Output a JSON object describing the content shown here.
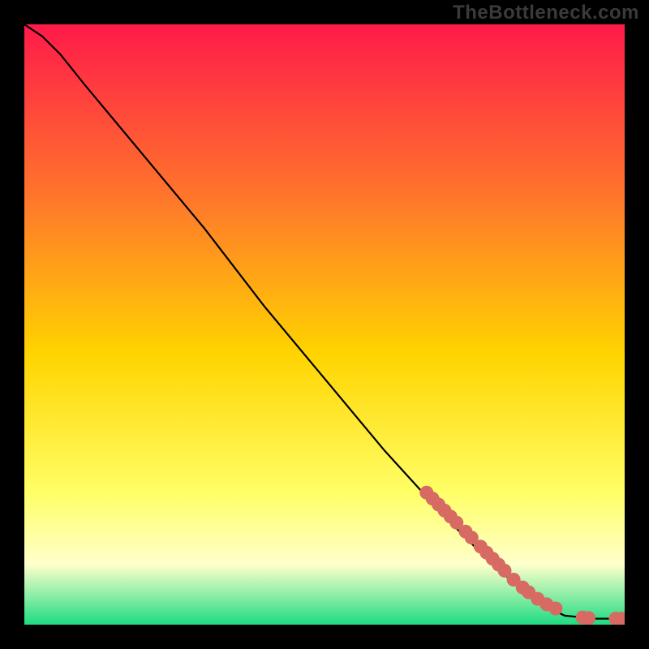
{
  "watermark": "TheBottleneck.com",
  "colors": {
    "gradient_top": "#ff1a4a",
    "gradient_mid1": "#ff7a2a",
    "gradient_mid2": "#ffd400",
    "gradient_mid3": "#ffff66",
    "gradient_mid4": "#ffffcc",
    "gradient_bottom": "#1edc82",
    "curve": "#000000",
    "marker_fill": "#d76a62",
    "marker_stroke": "#a84b44"
  },
  "chart_data": {
    "type": "line",
    "title": "",
    "xlabel": "",
    "ylabel": "",
    "xlim": [
      0,
      100
    ],
    "ylim": [
      0,
      100
    ],
    "curve": [
      {
        "x": 0,
        "y": 100
      },
      {
        "x": 3,
        "y": 98
      },
      {
        "x": 6,
        "y": 95
      },
      {
        "x": 10,
        "y": 90
      },
      {
        "x": 20,
        "y": 78
      },
      {
        "x": 30,
        "y": 66
      },
      {
        "x": 40,
        "y": 53
      },
      {
        "x": 50,
        "y": 41
      },
      {
        "x": 60,
        "y": 29
      },
      {
        "x": 70,
        "y": 18
      },
      {
        "x": 78,
        "y": 10
      },
      {
        "x": 85,
        "y": 4
      },
      {
        "x": 90,
        "y": 1.5
      },
      {
        "x": 95,
        "y": 1
      },
      {
        "x": 100,
        "y": 1
      }
    ],
    "markers": [
      {
        "x": 67,
        "y": 22.0
      },
      {
        "x": 68,
        "y": 21.0
      },
      {
        "x": 69,
        "y": 20.0
      },
      {
        "x": 70,
        "y": 19.0
      },
      {
        "x": 71,
        "y": 18.0
      },
      {
        "x": 72,
        "y": 17.0
      },
      {
        "x": 73.5,
        "y": 15.5
      },
      {
        "x": 74.5,
        "y": 14.5
      },
      {
        "x": 76,
        "y": 13.0
      },
      {
        "x": 77,
        "y": 12.0
      },
      {
        "x": 78,
        "y": 11.0
      },
      {
        "x": 79,
        "y": 10.0
      },
      {
        "x": 80,
        "y": 9.0
      },
      {
        "x": 81.5,
        "y": 7.5
      },
      {
        "x": 83,
        "y": 6.2
      },
      {
        "x": 84,
        "y": 5.4
      },
      {
        "x": 85.5,
        "y": 4.3
      },
      {
        "x": 87,
        "y": 3.4
      },
      {
        "x": 88.5,
        "y": 2.7
      },
      {
        "x": 93,
        "y": 1.2
      },
      {
        "x": 94,
        "y": 1.1
      },
      {
        "x": 98.5,
        "y": 1.0
      },
      {
        "x": 99.5,
        "y": 1.0
      }
    ]
  }
}
